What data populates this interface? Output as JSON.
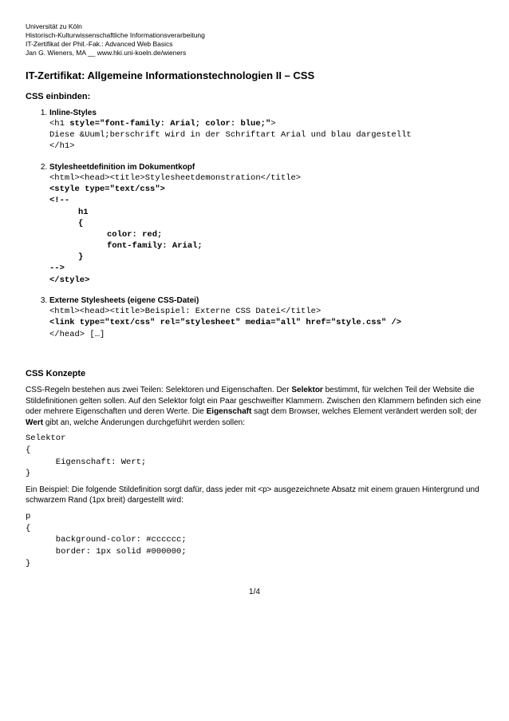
{
  "header": {
    "line1": "Universität zu Köln",
    "line2": "Historisch-Kulturwissenschaftliche Informationsverarbeitung",
    "line3": "IT-Zertifikat der Phil.-Fak.: Advanced Web Basics",
    "line4": "Jan G. Wieners, MA __  www.hki.uni-koeln.de/wieners"
  },
  "title": "IT-Zertifikat: Allgemeine Informationstechnologien II – CSS",
  "section1": {
    "heading": "CSS einbinden:",
    "items": [
      {
        "title": "Inline-Styles",
        "code_plain_prefix": "<h1 ",
        "code_bold": "style=\"font-family: Arial; color: blue;\"",
        "code_plain_suffix": ">",
        "code_line2": "Diese &Uuml;berschrift wird in der Schriftart Arial und blau dargestellt",
        "code_line3": "</h1>"
      },
      {
        "title": "Stylesheetdefinition im Dokumentkopf",
        "line1": "<html><head><title>Stylesheetdemonstration</title>",
        "line2_bold": "<style type=\"text/css\">",
        "line3_bold": "<!--",
        "line4_bold": "h1",
        "line5_bold": "{",
        "line6_bold": "color: red;",
        "line7_bold": "font-family: Arial;",
        "line8_bold": "}",
        "line9_bold": "-->",
        "line10_bold": "</style>"
      },
      {
        "title": "Externe Stylesheets (eigene CSS-Datei)",
        "line1": "<html><head><title>Beispiel: Externe CSS Datei</title>",
        "line2_bold": "<link type=\"text/css\" rel=\"stylesheet\" media=\"all\" href=\"style.css\" />",
        "line3": "</head> […]"
      }
    ]
  },
  "section2": {
    "heading": "CSS Konzepte",
    "para1_a": "CSS-Regeln bestehen aus zwei Teilen: Selektoren und Eigenschaften. Der ",
    "para1_b": "Selektor",
    "para1_c": " bestimmt, für welchen Teil der Website die Stildefinitionen gelten sollen. Auf den Selektor folgt ein Paar geschweifter Klammern. Zwischen den Klammern befinden sich eine oder mehrere Eigenschaften und deren Werte. Die ",
    "para1_d": "Eigenschaft",
    "para1_e": " sagt dem Browser, welches Element verändert werden soll; der ",
    "para1_f": "Wert",
    "para1_g": " gibt an, welche Änderungen durchgeführt werden sollen:",
    "codeblock1": "Selektor\n{\n      Eigenschaft: Wert;\n}",
    "para2": "Ein Beispiel: Die folgende Stildefinition sorgt dafür, dass jeder mit <p> ausgezeichnete Absatz mit einem grauen Hintergrund und schwarzem Rand (1px breit) dargestellt wird:",
    "codeblock2": "p\n{\n      background-color: #cccccc;\n      border: 1px solid #000000;\n}"
  },
  "page": "1/4"
}
